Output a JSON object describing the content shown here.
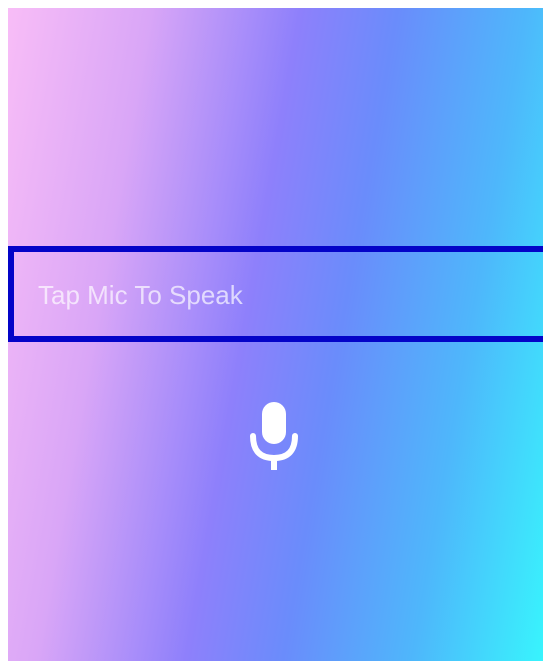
{
  "speech_box": {
    "placeholder": "Tap Mic To Speak"
  },
  "mic_button": {
    "icon": "microphone-icon",
    "color": "#ffffff"
  },
  "colors": {
    "box_border": "#0404c8",
    "gradient_start": "#f8bdf7",
    "gradient_mid": "#8e80fb",
    "gradient_end": "#38f4fd"
  }
}
